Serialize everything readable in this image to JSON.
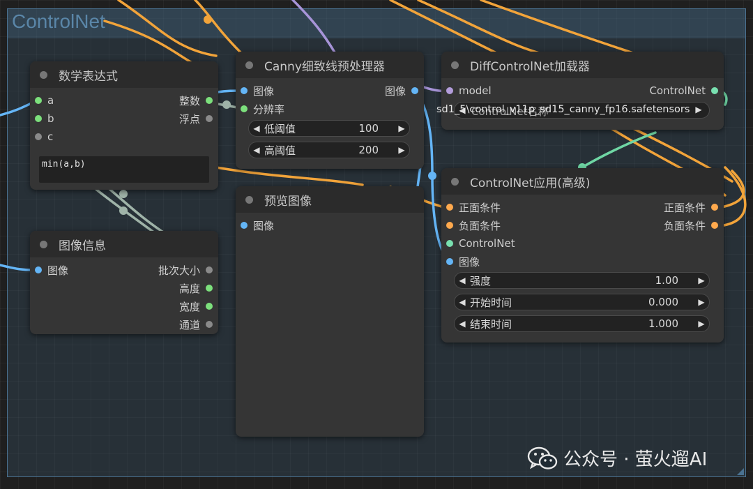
{
  "group": {
    "title": "ControlNet"
  },
  "nodes": {
    "math_expr": {
      "title": "数学表达式",
      "inputs": [
        "a",
        "b",
        "c"
      ],
      "outputs": [
        "整数",
        "浮点"
      ],
      "expression": "min(a,b)"
    },
    "image_info": {
      "title": "图像信息",
      "inputs": [
        "图像"
      ],
      "outputs": [
        "批次大小",
        "高度",
        "宽度",
        "通道"
      ]
    },
    "canny": {
      "title": "Canny细致线预处理器",
      "inputs": [
        "图像",
        "分辨率"
      ],
      "outputs": [
        "图像"
      ],
      "widgets": [
        {
          "label": "低阈值",
          "value": "100"
        },
        {
          "label": "高阈值",
          "value": "200"
        }
      ]
    },
    "preview": {
      "title": "预览图像",
      "inputs": [
        "图像"
      ]
    },
    "diff_loader": {
      "title": "DiffControlNet加载器",
      "inputs": [
        "model"
      ],
      "outputs": [
        "ControlNet"
      ],
      "model_widget_label": "sd1_5\\control_v11p_sd15_canny_fp16.safetensors",
      "model_widget_overlap": "ControlNet名称"
    },
    "apply_adv": {
      "title": "ControlNet应用(高级)",
      "inputs": [
        "正面条件",
        "负面条件",
        "ControlNet",
        "图像"
      ],
      "outputs": [
        "正面条件",
        "负面条件"
      ],
      "widgets": [
        {
          "label": "强度",
          "value": "1.00"
        },
        {
          "label": "开始时间",
          "value": "0.000"
        },
        {
          "label": "结束时间",
          "value": "1.000"
        }
      ]
    }
  },
  "watermark": {
    "text": "公众号 · 萤火遛AI",
    "icon": "wechat-icon"
  },
  "colors": {
    "wire_blue": "#64b5f6",
    "wire_orange": "#f2a43a",
    "wire_purple": "#a794d8",
    "wire_teal": "#6fd6a4",
    "wire_grey": "#9fb3a8"
  }
}
